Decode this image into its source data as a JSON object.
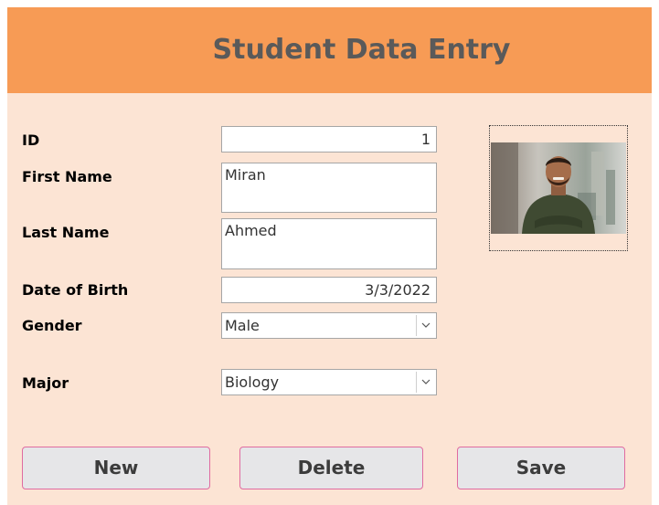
{
  "form": {
    "title": "Student Data Entry",
    "fields": {
      "id": {
        "label": "ID",
        "value": "1"
      },
      "first_name": {
        "label": "First Name",
        "value": "Miran"
      },
      "last_name": {
        "label": "Last Name",
        "value": "Ahmed"
      },
      "dob": {
        "label": "Date of Birth",
        "value": "3/3/2022"
      },
      "gender": {
        "label": "Gender",
        "value": "Male"
      },
      "major": {
        "label": "Major",
        "value": "Biology"
      }
    },
    "buttons": {
      "new": "New",
      "delete": "Delete",
      "save": "Save"
    },
    "colors": {
      "header_bg": "#f79b55",
      "form_bg": "#fce4d4",
      "button_border": "#e06ca0",
      "button_bg": "#e6e6e8"
    }
  }
}
